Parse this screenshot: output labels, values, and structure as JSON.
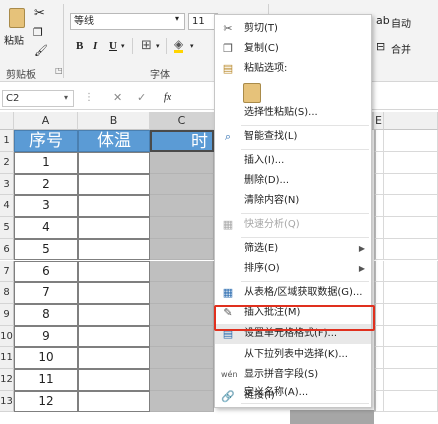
{
  "ribbon": {
    "cut_label": "",
    "paste_label": "粘贴",
    "clipboard_label": "剪贴板",
    "font_name": "等线",
    "font_size": "11",
    "bold": "B",
    "italic": "I",
    "underline": "U",
    "font_group_label": "字体",
    "autowrap_label": "自动",
    "merge_label": "合并"
  },
  "formula_bar": {
    "name_box": "C2",
    "fx": "fx"
  },
  "columns": [
    "A",
    "B",
    "C",
    "E"
  ],
  "rows": [
    "1",
    "2",
    "3",
    "4",
    "5",
    "6",
    "7",
    "8",
    "9",
    "10",
    "11",
    "12",
    "13"
  ],
  "table": {
    "header_seq": "序号",
    "header_temp": "体温",
    "header_time_partial": "时",
    "seq_values": [
      "1",
      "2",
      "3",
      "4",
      "5",
      "6",
      "7",
      "8",
      "9",
      "10",
      "11",
      "12"
    ]
  },
  "context_menu": {
    "items": [
      {
        "label": "剪切(T)",
        "icon": "scissors-icon"
      },
      {
        "label": "复制(C)",
        "icon": "copy-icon"
      },
      {
        "label": "粘贴选项:",
        "icon": "paste-icon"
      },
      {
        "label": "选择性粘贴(S)...",
        "icon": ""
      },
      {
        "label": "智能查找(L)",
        "icon": "search-icon"
      },
      {
        "label": "插入(I)...",
        "icon": ""
      },
      {
        "label": "删除(D)...",
        "icon": ""
      },
      {
        "label": "清除内容(N)",
        "icon": ""
      },
      {
        "label": "快速分析(Q)",
        "icon": "quick-analysis-icon"
      },
      {
        "label": "筛选(E)",
        "icon": ""
      },
      {
        "label": "排序(O)",
        "icon": ""
      },
      {
        "label": "从表格/区域获取数据(G)...",
        "icon": "table-icon"
      },
      {
        "label": "插入批注(M)",
        "icon": "comment-icon"
      },
      {
        "label": "设置单元格格式(F)...",
        "icon": "format-cells-icon"
      },
      {
        "label": "从下拉列表中选择(K)...",
        "icon": ""
      },
      {
        "label": "显示拼音字段(S)",
        "icon": "pinyin-icon"
      },
      {
        "label": "定义名称(A)...",
        "icon": ""
      },
      {
        "label": "链接(I)",
        "icon": "link-icon"
      }
    ]
  },
  "colors": {
    "header_blue": "#5b9bd5",
    "highlight_red": "#e0301e",
    "selected_gray": "#bfbfbf"
  }
}
